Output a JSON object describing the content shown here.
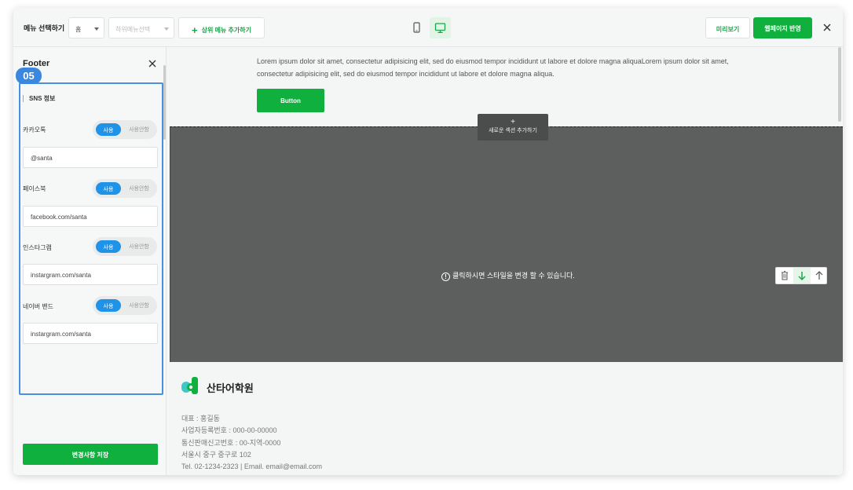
{
  "topbar": {
    "menu_label": "메뉴 선택하기",
    "top_menu_value": "홈",
    "sub_menu_placeholder": "하위메뉴선택",
    "add_top_menu": "상위 메뉴 추가하기",
    "preview": "미리보기",
    "publish": "웹페이지 반영"
  },
  "sidebar": {
    "title": "Footer",
    "step_badge": "05",
    "section_title": "SNS 정보",
    "toggle_on": "사용",
    "toggle_off": "사용안함",
    "rows": [
      {
        "label": "카카오톡",
        "value": "@santa"
      },
      {
        "label": "페이스북",
        "value": "facebook.com/santa"
      },
      {
        "label": "인스타그램",
        "value": "instargram.com/santa"
      },
      {
        "label": "네이버 밴드",
        "value": "instargram.com/santa"
      }
    ],
    "save_button": "변경사항 저장"
  },
  "canvas": {
    "hero_text": "Lorem ipsum dolor sit amet, consectetur adipisicing elit, sed do eiusmod tempor incididunt ut labore et dolore magna aliquaLorem ipsum dolor sit amet, consectetur adipisicing elit, sed do eiusmod tempor incididunt ut labore et dolore magna aliqua.",
    "hero_button": "Button",
    "add_section_plus": "+",
    "add_section": "새로운 섹션 추가하기",
    "style_message": "클릭하시면 스타일을 변경 할 수 있습니다.",
    "info_glyph": "!"
  },
  "footer": {
    "brand": "산타어학원",
    "lines": [
      "대표 : 홍길동",
      "사업자등록번호 : 000-00-00000",
      "통신판매신고번호 : 00-지역-0000",
      "서울시 중구 중구로 102",
      "Tel. 02-1234-2323 | Email. email@email.com"
    ]
  },
  "colors": {
    "accent_green": "#10b03f",
    "highlight_blue": "#4a90e2",
    "toggle_blue": "#1f93e8",
    "dark_section": "#5d5e5e"
  },
  "icons": [
    "plus-icon",
    "mobile-icon",
    "desktop-icon",
    "close-icon",
    "info-icon",
    "trash-icon",
    "arrow-down-icon",
    "arrow-up-icon",
    "brand-logo-icon"
  ]
}
